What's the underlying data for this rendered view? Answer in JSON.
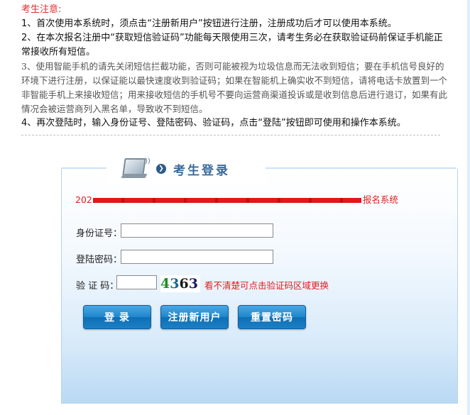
{
  "notice": {
    "title": "考生注意:",
    "items": [
      "1、首次使用本系统时，须点击“注册新用户”按钮进行注册，注册成功后才可以使用本系统。",
      "2、在本次报名注册中“获取短信验证码”功能每天限使用三次，请考生务必在获取验证码前保证手机能正常接收所有短信。",
      "3、使用智能手机的请先关闭短信拦截功能，否则可能被视为垃圾信息而无法收到短信；要在手机信号良好的环境下进行注册，以保证能以最快速度收到验证码；如果在智能机上确实收不到短信，请将电话卡放置到一个非智能手机上来接收短信；用来接收短信的手机号不要向运营商渠道投诉或是收到信息后进行退订，如果有此情况会被运营商列入黑名单，导致收不到短信。",
      "4、再次登陆时，输入身份证号、登陆密码、验证码，点击“登陆”按钮即可使用和操作本系统。"
    ]
  },
  "login": {
    "title": "考生登录",
    "system_year": "202",
    "system_suffix": "报名系统",
    "id_label": "身份证号：",
    "password_label": "登陆密码：",
    "captcha_label": "验 证 码：",
    "id_value": "",
    "password_value": "",
    "captcha_value": "",
    "captcha_chars": [
      "4",
      "3",
      "6",
      "3"
    ],
    "captcha_hint": "看不清楚可点击验证码区域更换",
    "buttons": {
      "login": "登 录",
      "register": "注册新用户",
      "reset": "重置密码"
    }
  },
  "colors": {
    "notice_title": "#e03030",
    "system_name": "#e02020",
    "button_blue": "#1f86cc",
    "header_title": "#3a6a9a"
  },
  "icons": {
    "header": "laptop-icon",
    "header_arrow": "arrow-right-circle-icon"
  }
}
